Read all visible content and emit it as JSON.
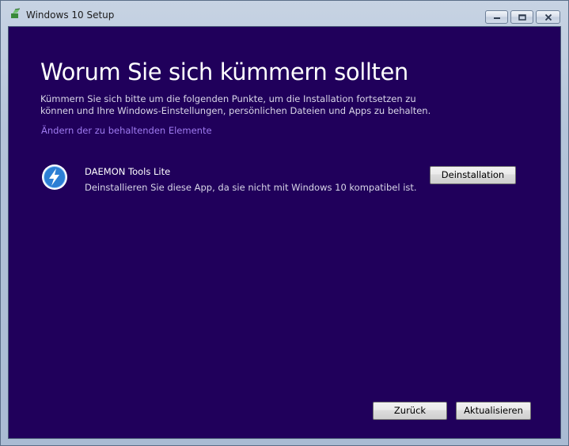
{
  "window": {
    "title": "Windows 10 Setup",
    "title_icon": "setup-icon",
    "controls": {
      "minimize": "minimize-icon",
      "maximize": "maximize-icon",
      "close": "close-icon"
    }
  },
  "main": {
    "heading": "Worum Sie sich kümmern sollten",
    "subtitle": "Kümmern Sie sich bitte um die folgenden Punkte, um die Installation fortsetzen zu können und Ihre Windows-Einstellungen, persönlichen Dateien und Apps zu behalten.",
    "change_link": "Ändern der zu behaltenden Elemente",
    "items": [
      {
        "name": "DAEMON Tools Lite",
        "description": "Deinstallieren Sie diese App, da sie nicht mit Windows 10 kompatibel ist.",
        "icon": "daemon-tools-icon",
        "action_label": "Deinstallation"
      }
    ]
  },
  "footer": {
    "back_label": "Zurück",
    "update_label": "Aktualisieren"
  },
  "colors": {
    "background": "#20005b",
    "link": "#9f7bf0",
    "text": "#ffffff"
  }
}
